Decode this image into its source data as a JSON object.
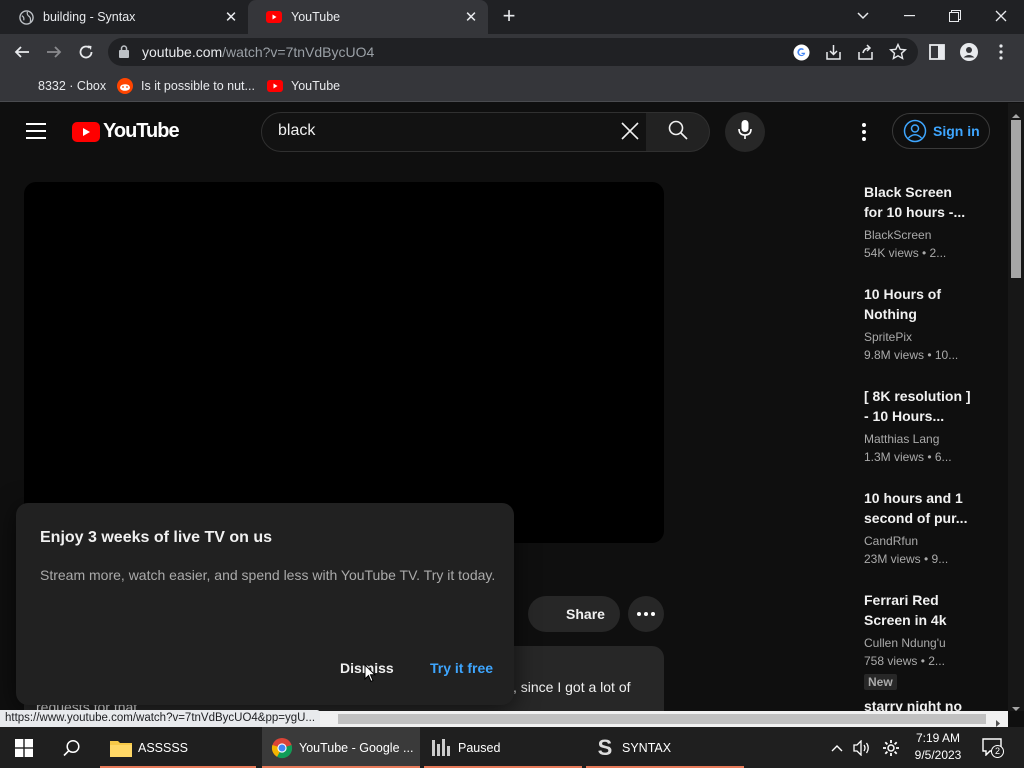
{
  "browser": {
    "tabs": [
      {
        "title": "building - Syntax",
        "active": false
      },
      {
        "title": "YouTube",
        "active": true
      }
    ],
    "url_host": "youtube.com",
    "url_path": "/watch?v=7tnVdBycUO4",
    "bookmarks": [
      {
        "label": "8332 · Cbox"
      },
      {
        "label": "Is it possible to nut..."
      },
      {
        "label": "YouTube"
      }
    ],
    "status_url": "https://www.youtube.com/watch?v=7tnVdBycUO4&pp=ygU..."
  },
  "youtube": {
    "logo_text": "YouTube",
    "search_query": "black",
    "signin_label": "Sign in",
    "share_label": "Share",
    "description_fragment": ", since I got a lot of",
    "description_fragment2": "requests for that",
    "promo": {
      "title": "Enjoy 3 weeks of live TV on us",
      "body": "Stream more, watch easier, and spend less with YouTube TV. Try it today.",
      "dismiss_label": "Dismiss",
      "try_label": "Try it free"
    },
    "recommendations": [
      {
        "title_line1": "Black Screen",
        "title_line2": "for 10 hours -...",
        "channel": "BlackScreen",
        "meta": "54K views  • 2..."
      },
      {
        "title_line1": "10 Hours of",
        "title_line2": "Nothing",
        "channel": "SpritePix",
        "meta": "9.8M views  • 10..."
      },
      {
        "title_line1": "[ 8K resolution ]",
        "title_line2": "- 10 Hours...",
        "channel": "Matthias Lang",
        "meta": "1.3M views  • 6..."
      },
      {
        "title_line1": "10 hours and 1",
        "title_line2": "second of pur...",
        "channel": "CandRfun",
        "meta": "23M views  • 9..."
      },
      {
        "title_line1": "Ferrari Red",
        "title_line2": "Screen in 4k",
        "channel": "Cullen Ndung'u",
        "meta": "758 views  • 2...",
        "badge": "New"
      },
      {
        "title_line1": "starry night no",
        "title_line2": "",
        "channel": "",
        "meta": ""
      }
    ]
  },
  "taskbar": {
    "items": [
      {
        "label": "ASSSSS"
      },
      {
        "label": "YouTube - Google ..."
      },
      {
        "label": "Paused"
      },
      {
        "label": "SYNTAX"
      }
    ],
    "time": "7:19 AM",
    "date": "9/5/2023",
    "notification_count": "2"
  },
  "colors": {
    "yt_red": "#ff0000",
    "link_blue": "#3ea6ff",
    "taskbar_accent": "#e87b5a"
  }
}
